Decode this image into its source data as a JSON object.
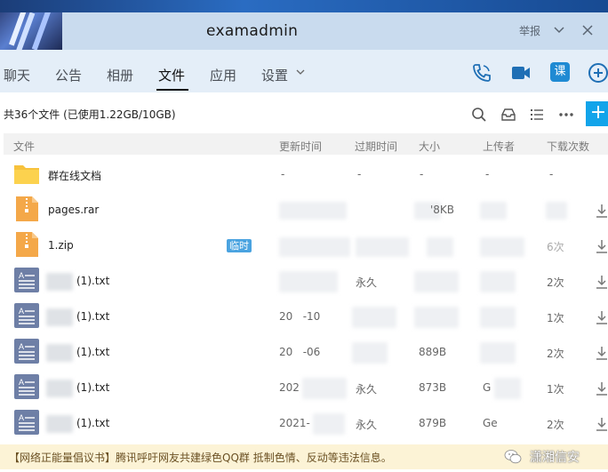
{
  "window": {
    "title": "examadmin",
    "report_label": "举报"
  },
  "tabs": [
    {
      "label": "聊天"
    },
    {
      "label": "公告"
    },
    {
      "label": "相册"
    },
    {
      "label": "文件",
      "active": true
    },
    {
      "label": "应用"
    },
    {
      "label": "设置"
    }
  ],
  "toolbar": {
    "ke_label": "课",
    "upload_label": "+"
  },
  "files": {
    "summary": "共36个文件 (已使用1.22GB/10GB)"
  },
  "columns": {
    "name": "文件",
    "updated": "更新时间",
    "expires": "过期时间",
    "size": "大小",
    "uploader": "上传者",
    "downloads": "下载次数"
  },
  "rows": [
    {
      "name": "群在线文档",
      "icon": "folder-icon",
      "updated": "-",
      "expires": "-",
      "size": "-",
      "uploader": "-",
      "downloads": "-"
    },
    {
      "name": "pages.rar",
      "icon": "archive-file-icon",
      "updated": "",
      "expires": "",
      "size": "'8KB",
      "uploader": "",
      "downloads": ""
    },
    {
      "name": "1.zip",
      "icon": "archive-file-icon",
      "badge": "临时",
      "updated": "",
      "expires": "",
      "size": "",
      "uploader": "",
      "downloads": "6次"
    },
    {
      "name": "(1).txt",
      "icon": "text-file-icon",
      "updated": "",
      "expires": "永久",
      "size": "",
      "uploader": "",
      "downloads": "2次"
    },
    {
      "name": "(1).txt",
      "icon": "text-file-icon",
      "updated": "20   -10",
      "expires": "",
      "size": "",
      "uploader": "",
      "downloads": "1次"
    },
    {
      "name": "(1).txt",
      "icon": "text-file-icon",
      "updated": "20   -06",
      "expires": "",
      "size": "889B",
      "uploader": "",
      "downloads": "2次"
    },
    {
      "name": "(1).txt",
      "icon": "text-file-icon",
      "updated": "202",
      "expires": "永久",
      "size": "873B",
      "uploader": "G",
      "downloads": "1次"
    },
    {
      "name": "(1).txt",
      "icon": "text-file-icon",
      "updated": "2021-",
      "expires": "永久",
      "size": "879B",
      "uploader": "Ge",
      "downloads": "2次"
    }
  ],
  "notice": {
    "text": "【网络正能量倡议书】腾讯呼吁网友共建绿色QQ群 抵制色情、反动等违法信息。"
  },
  "watermark": {
    "text": "潇湘信安"
  },
  "colors": {
    "accent": "#12a4ea",
    "titlebar": "#c9dbee",
    "tabbar": "#e4eef8",
    "notice": "#fcf3d6"
  }
}
